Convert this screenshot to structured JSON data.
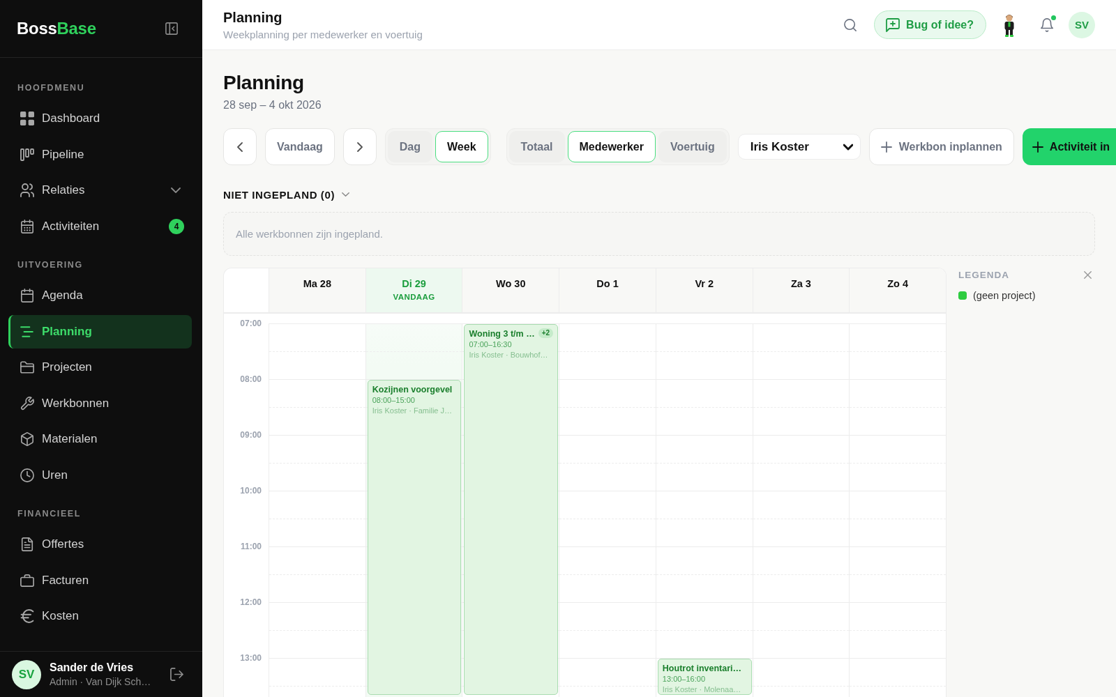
{
  "sidebar": {
    "brand": "Boss",
    "brand_accent": "Base",
    "sections": [
      {
        "title": "HOOFDMENU",
        "items": [
          {
            "label": "Dashboard",
            "selected": false
          },
          {
            "label": "Pipeline",
            "selected": false
          },
          {
            "label": "Relaties",
            "selected": false,
            "expanded": false
          },
          {
            "label": "Activiteiten",
            "selected": false,
            "badge": "4"
          }
        ]
      },
      {
        "title": "UITVOERING",
        "items": [
          {
            "label": "Agenda",
            "selected": false
          },
          {
            "label": "Planning",
            "selected": true
          },
          {
            "label": "Projecten",
            "selected": false
          },
          {
            "label": "Werkbonnen",
            "selected": false
          },
          {
            "label": "Materialen",
            "selected": false
          },
          {
            "label": "Uren",
            "selected": false
          }
        ]
      },
      {
        "title": "FINANCIEEL",
        "items": [
          {
            "label": "Offertes",
            "selected": false
          },
          {
            "label": "Facturen",
            "selected": false
          },
          {
            "label": "Kosten",
            "selected": false
          }
        ]
      }
    ],
    "user": {
      "initials": "SV",
      "name": "Sander de Vries",
      "role": "Admin · Van Dijk Sch…"
    }
  },
  "header": {
    "title": "Planning",
    "subtitle": "Weekplanning per medewerker en voertuig",
    "feedback_button": "Bug of idee?",
    "notifications_unread": true,
    "avatar_initials": "SV"
  },
  "page": {
    "title": "Planning",
    "date_range": "28 sep – 4 okt 2026"
  },
  "toolbar": {
    "today_button": "Vandaag",
    "view_tabs": [
      {
        "label": "Dag",
        "selected": false
      },
      {
        "label": "Week",
        "selected": true
      }
    ],
    "group_tabs": [
      {
        "label": "Totaal",
        "selected": false
      },
      {
        "label": "Medewerker",
        "selected": true
      },
      {
        "label": "Voertuig",
        "selected": false
      }
    ],
    "employee_select": {
      "value": "Iris Koster"
    },
    "actions": [
      {
        "label": "Werkbon inplannen",
        "kind": "secondary"
      },
      {
        "label": "Activiteit in",
        "kind": "primary"
      }
    ]
  },
  "unplanned": {
    "title": "NIET INGEPLAND (0)",
    "empty_message": "Alle werkbonnen zijn ingepland."
  },
  "calendar": {
    "days": [
      {
        "label": "Ma 28",
        "today": false
      },
      {
        "label": "Di 29",
        "today": true,
        "today_label": "VANDAAG",
        "events": [
          {
            "title": "Kozijnen voorgevel",
            "time": "08:00–15:00",
            "meta": "Iris Koster · Familie J…"
          }
        ]
      },
      {
        "label": "Wo 30",
        "today": false,
        "events": [
          {
            "title": "Woning 3 t/m …",
            "more": "+2",
            "time": "07:00–16:30",
            "meta": "Iris Koster · Bouwhof…"
          }
        ]
      },
      {
        "label": "Do 1",
        "today": false
      },
      {
        "label": "Vr 2",
        "today": false,
        "events": [
          {
            "title": "Houtrot inventari…",
            "time": "13:00–16:00",
            "meta": "Iris Koster · Molenaa…"
          }
        ]
      },
      {
        "label": "Za 3",
        "today": false
      },
      {
        "label": "Zo 4",
        "today": false
      }
    ],
    "hours": [
      "07:00",
      "08:00",
      "09:00",
      "10:00",
      "11:00",
      "12:00",
      "13:00"
    ]
  },
  "legend": {
    "title": "LEGENDA",
    "items": [
      {
        "label": "(geen project)",
        "color": "#2ecc40"
      }
    ]
  }
}
